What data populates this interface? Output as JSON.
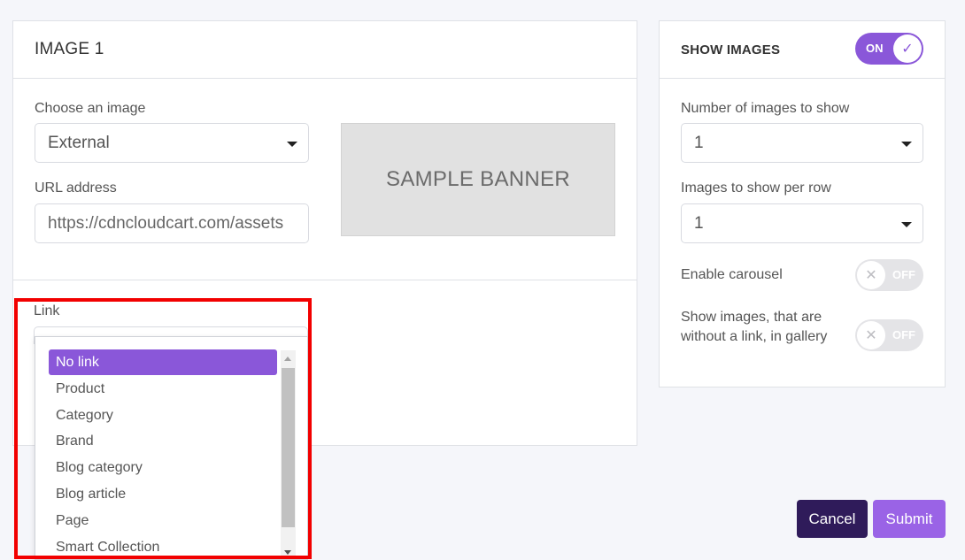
{
  "image_panel": {
    "title": "IMAGE 1",
    "choose_label": "Choose an image",
    "choose_value": "External",
    "url_label": "URL address",
    "url_value": "https://cdncloudcart.com/assets",
    "banner_text": "SAMPLE BANNER",
    "link_label": "Link"
  },
  "link_dropdown": {
    "options": [
      "No link",
      "Product",
      "Category",
      "Brand",
      "Blog category",
      "Blog article",
      "Page",
      "Smart Collection"
    ],
    "selected": "No link"
  },
  "settings_panel": {
    "title": "SHOW IMAGES",
    "show_toggle": {
      "state": "on",
      "label": "ON",
      "icon": "check-icon"
    },
    "count_label": "Number of images to show",
    "count_value": "1",
    "per_row_label": "Images to show per row",
    "per_row_value": "1",
    "carousel_label": "Enable carousel",
    "carousel_toggle": {
      "state": "off",
      "label": "OFF",
      "icon": "x-icon"
    },
    "without_link_label": "Show images, that are without a link, in gallery",
    "without_link_toggle": {
      "state": "off",
      "label": "OFF",
      "icon": "x-icon"
    }
  },
  "footer": {
    "cancel_label": "Cancel",
    "submit_label": "Submit"
  },
  "colors": {
    "accent": "#8a57d9",
    "cancel_bg": "#2f1b5a",
    "submit_bg": "#9a63e6",
    "highlight": "#f20000"
  }
}
